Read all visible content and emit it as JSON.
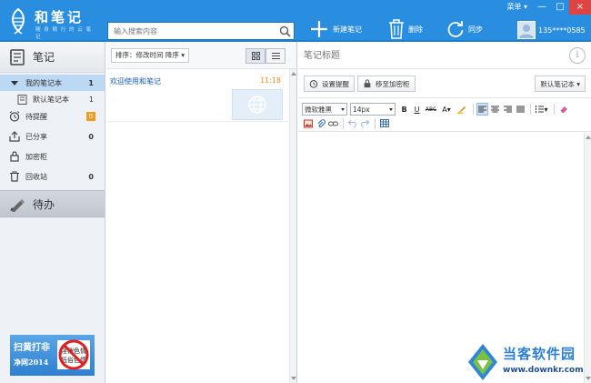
{
  "app": {
    "name": "和笔记",
    "slogan": "随 身 随 行 的 云 笔 记"
  },
  "top_menu": {
    "menu_label": "菜单"
  },
  "window_controls": {
    "minimize": "—",
    "maximize": "□",
    "close": "×"
  },
  "search": {
    "placeholder": "输入搜索内容"
  },
  "toolbar": {
    "new_note": "新建笔记",
    "delete": "删除",
    "sync": "同步"
  },
  "user": {
    "phone": "135****0585"
  },
  "sidebar": {
    "notes_header": "笔记",
    "items": [
      {
        "label": "我的笔记本",
        "count": "1"
      },
      {
        "label": "默认笔记本",
        "count": "1"
      },
      {
        "label": "待提醒",
        "count": "0"
      },
      {
        "label": "已分享",
        "count": "0"
      },
      {
        "label": "加密柜",
        "count": ""
      },
      {
        "label": "回收站",
        "count": "0"
      }
    ],
    "todo_header": "待办",
    "ad": {
      "line1": "扫黄打非",
      "line2": "净网2014",
      "sign": "淫秽色情 低俗色情"
    }
  },
  "note_list": {
    "sort_label": "排序：修改时间  降序",
    "notes": [
      {
        "title": "欢迎使用和笔记",
        "time": "11:18"
      }
    ]
  },
  "editor": {
    "title_placeholder": "笔记标题",
    "info_icon": "i",
    "set_reminder": "设置提醒",
    "move_to_vault": "移至加密柜",
    "notebook_select": "默认笔记本",
    "font_family": "微软雅黑",
    "font_size": "14px",
    "bold": "B",
    "underline": "U",
    "strikethrough": "ABC",
    "font_color": "A"
  },
  "watermark": {
    "name": "当客软件园",
    "url": "www.downkr.com"
  },
  "colors": {
    "topbar": "#2a8ee0",
    "active_item": "#bcd9f3",
    "badge": "#f29a1d",
    "note_title": "#1a5fb4",
    "note_time": "#f0901a"
  }
}
